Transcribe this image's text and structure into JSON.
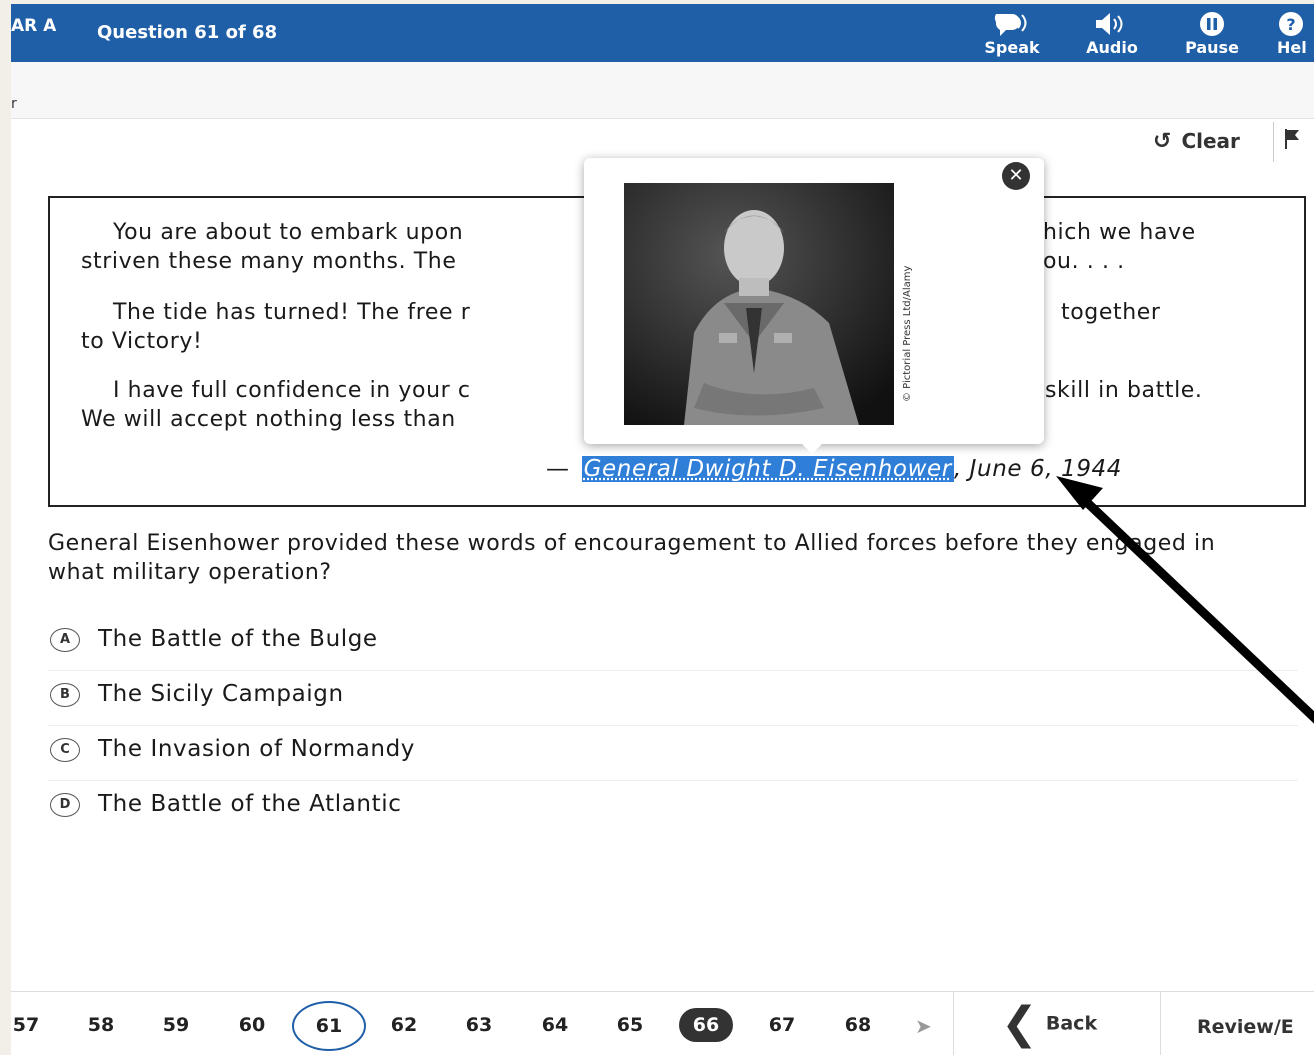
{
  "header": {
    "test_name": "AR A",
    "question_counter": "Question 61 of 68",
    "tools": [
      {
        "label": "Speak",
        "icon": "speak-icon"
      },
      {
        "label": "Audio",
        "icon": "audio-icon"
      },
      {
        "label": "Pause",
        "icon": "pause-icon"
      },
      {
        "label": "Hel",
        "icon": "help-icon"
      }
    ]
  },
  "subbar": {
    "crumb": "r"
  },
  "toolbar": {
    "clear_label": "Clear",
    "clear_icon": "undo-icon",
    "flag_icon": "flag-icon"
  },
  "passage": {
    "p1_start": "You are about to embark upon",
    "p1_end": "hich we have",
    "p1_line2_start": "striven these many months. The",
    "p1_line2_end": "ou. . . .",
    "p2_start": "The tide has turned! The free r",
    "p2_end": "together",
    "p2_line2": "to Victory!",
    "p3_start": "I have full confidence in your c",
    "p3_end": "skill in battle.",
    "p3_line2": "We will accept nothing less than",
    "attribution_dash": "—",
    "attribution_link": "General Dwight D. Eisenhower",
    "attribution_date": ", June 6, 1944"
  },
  "popup": {
    "close_icon": "close-icon",
    "photo_credit": "© Pictorial Press Ltd/Alamy"
  },
  "question": {
    "text": "General Eisenhower provided these words of encouragement to Allied forces before they engaged in what military operation?",
    "options": [
      {
        "letter": "A",
        "text": "The Battle of the Bulge"
      },
      {
        "letter": "B",
        "text": "The Sicily Campaign"
      },
      {
        "letter": "C",
        "text": "The Invasion of Normandy"
      },
      {
        "letter": "D",
        "text": "The Battle of the Atlantic"
      }
    ]
  },
  "bottom_nav": {
    "questions": [
      "57",
      "58",
      "59",
      "60",
      "61",
      "62",
      "63",
      "64",
      "65",
      "66",
      "67",
      "68"
    ],
    "current": "61",
    "answered": "66",
    "back_label": "Back",
    "review_label": "Review/E"
  },
  "colors": {
    "header_bg": "#1f5fa8",
    "highlight": "#2f7ed8"
  }
}
